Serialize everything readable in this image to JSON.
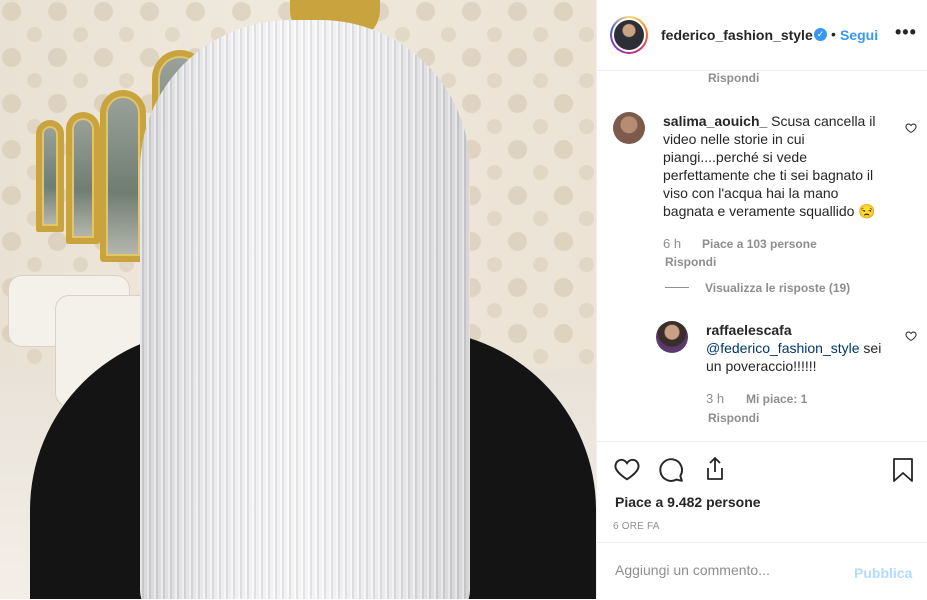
{
  "post": {
    "username": "federico_fashion_style",
    "verified_icon": "verified-badge-icon",
    "separator": "•",
    "follow_label": "Segui",
    "more_icon": "more-options-icon",
    "more_glyph": "•••"
  },
  "comments": {
    "top_reply_label": "Rispondi",
    "items": [
      {
        "username": "salima_aouich_",
        "text": "Scusa cancella il video nelle storie in cui piangi....perché si vede perfettamente che ti sei bagnato il viso con l'acqua hai la mano bagnata e veramente squallido 😒",
        "time": "6 h",
        "likes": "Piace a 103 persone",
        "reply_label": "Rispondi",
        "view_replies": "Visualizza le risposte (19)"
      },
      {
        "username": "raffaelescafa",
        "mention": "@federico_fashion_style",
        "text": " sei un poveraccio!!!!!!",
        "time": "3 h",
        "likes": "Mi piace: 1",
        "reply_label": "Rispondi"
      }
    ]
  },
  "actions": {
    "like_icon": "heart-icon",
    "comment_icon": "comment-icon",
    "share_icon": "share-icon",
    "save_icon": "bookmark-icon",
    "likes_text": "Piace a 9.482 persone",
    "timestamp": "6 ORE FA"
  },
  "add_comment": {
    "placeholder": "Aggiungi un commento...",
    "publish_label": "Pubblica"
  },
  "colors": {
    "link_blue": "#3897f0",
    "mention_blue": "#00376b",
    "muted": "#8e8e8e",
    "publish_disabled": "#b3dbff"
  }
}
